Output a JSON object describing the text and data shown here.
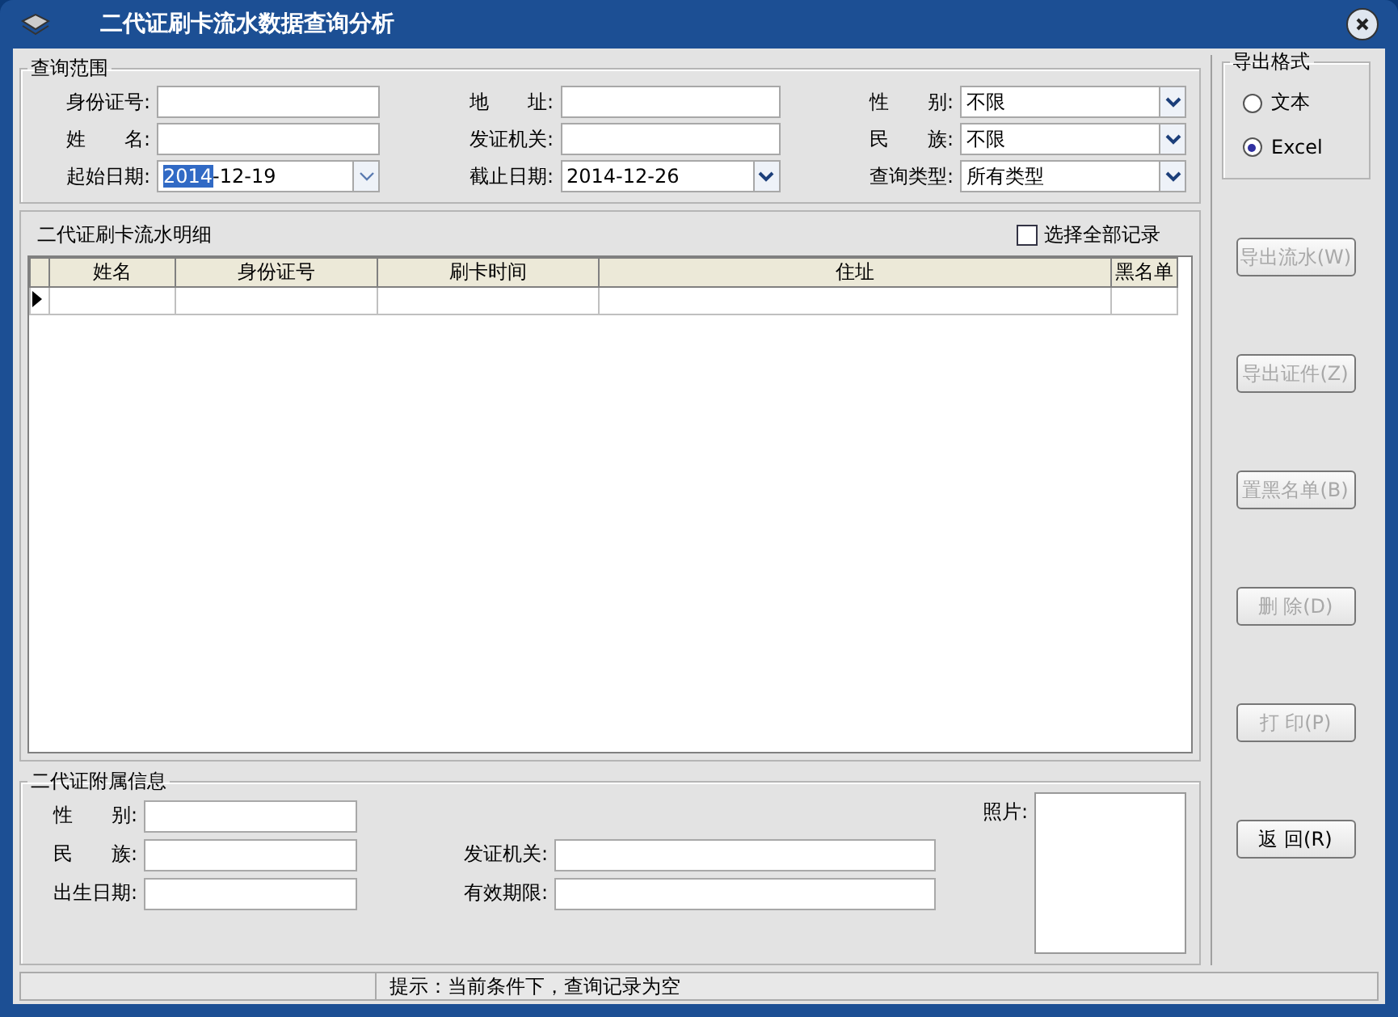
{
  "window": {
    "title": "二代证刷卡流水数据查询分析"
  },
  "query": {
    "label": "查询范围",
    "fields": [
      {
        "label": "身份证号:",
        "kind": "text"
      },
      {
        "label": "地　　址:",
        "kind": "text"
      },
      {
        "label": "性　　别:",
        "kind": "select",
        "value": "不限"
      },
      {
        "label": "姓　　名:",
        "kind": "text"
      },
      {
        "label": "发证机关:",
        "kind": "text"
      },
      {
        "label": "民　　族:",
        "kind": "select",
        "value": "不限"
      },
      {
        "label": "起始日期:",
        "kind": "date",
        "selected_part": "2014",
        "value": "-12-19"
      },
      {
        "label": "截止日期:",
        "kind": "select",
        "value": "2014-12-26"
      },
      {
        "label": "查询类型:",
        "kind": "select",
        "value": "所有类型"
      }
    ]
  },
  "export_format": {
    "label": "导出格式",
    "options": [
      {
        "label": "文本",
        "selected": false
      },
      {
        "label": "Excel",
        "selected": true
      }
    ]
  },
  "records": {
    "label": "二代证刷卡流水明细",
    "select_all": {
      "label": "选择全部记录",
      "checked": false
    },
    "columns": [
      "姓名",
      "身份证号",
      "刷卡时间",
      "住址",
      "黑名单"
    ]
  },
  "attached": {
    "label": "二代证附属信息",
    "photo_label": "照片:",
    "personal_fields": [
      {
        "label": "性　　别:"
      },
      {
        "label": "民　　族:"
      },
      {
        "label": "出生日期:"
      }
    ],
    "card_fields": [
      {
        "label": "发证机关:"
      },
      {
        "label": "有效期限:"
      }
    ]
  },
  "buttons": [
    {
      "label": "导出流水(W)",
      "disabled": true
    },
    {
      "label": "导出证件(Z)",
      "disabled": true
    },
    {
      "label": "置黑名单(B)",
      "disabled": true
    },
    {
      "label": "删 除(D)",
      "disabled": true
    },
    {
      "label": "打 印(P)",
      "disabled": true
    },
    {
      "label": "返 回(R)",
      "disabled": false
    }
  ],
  "status": {
    "text": "提示：当前条件下，查询记录为空"
  }
}
